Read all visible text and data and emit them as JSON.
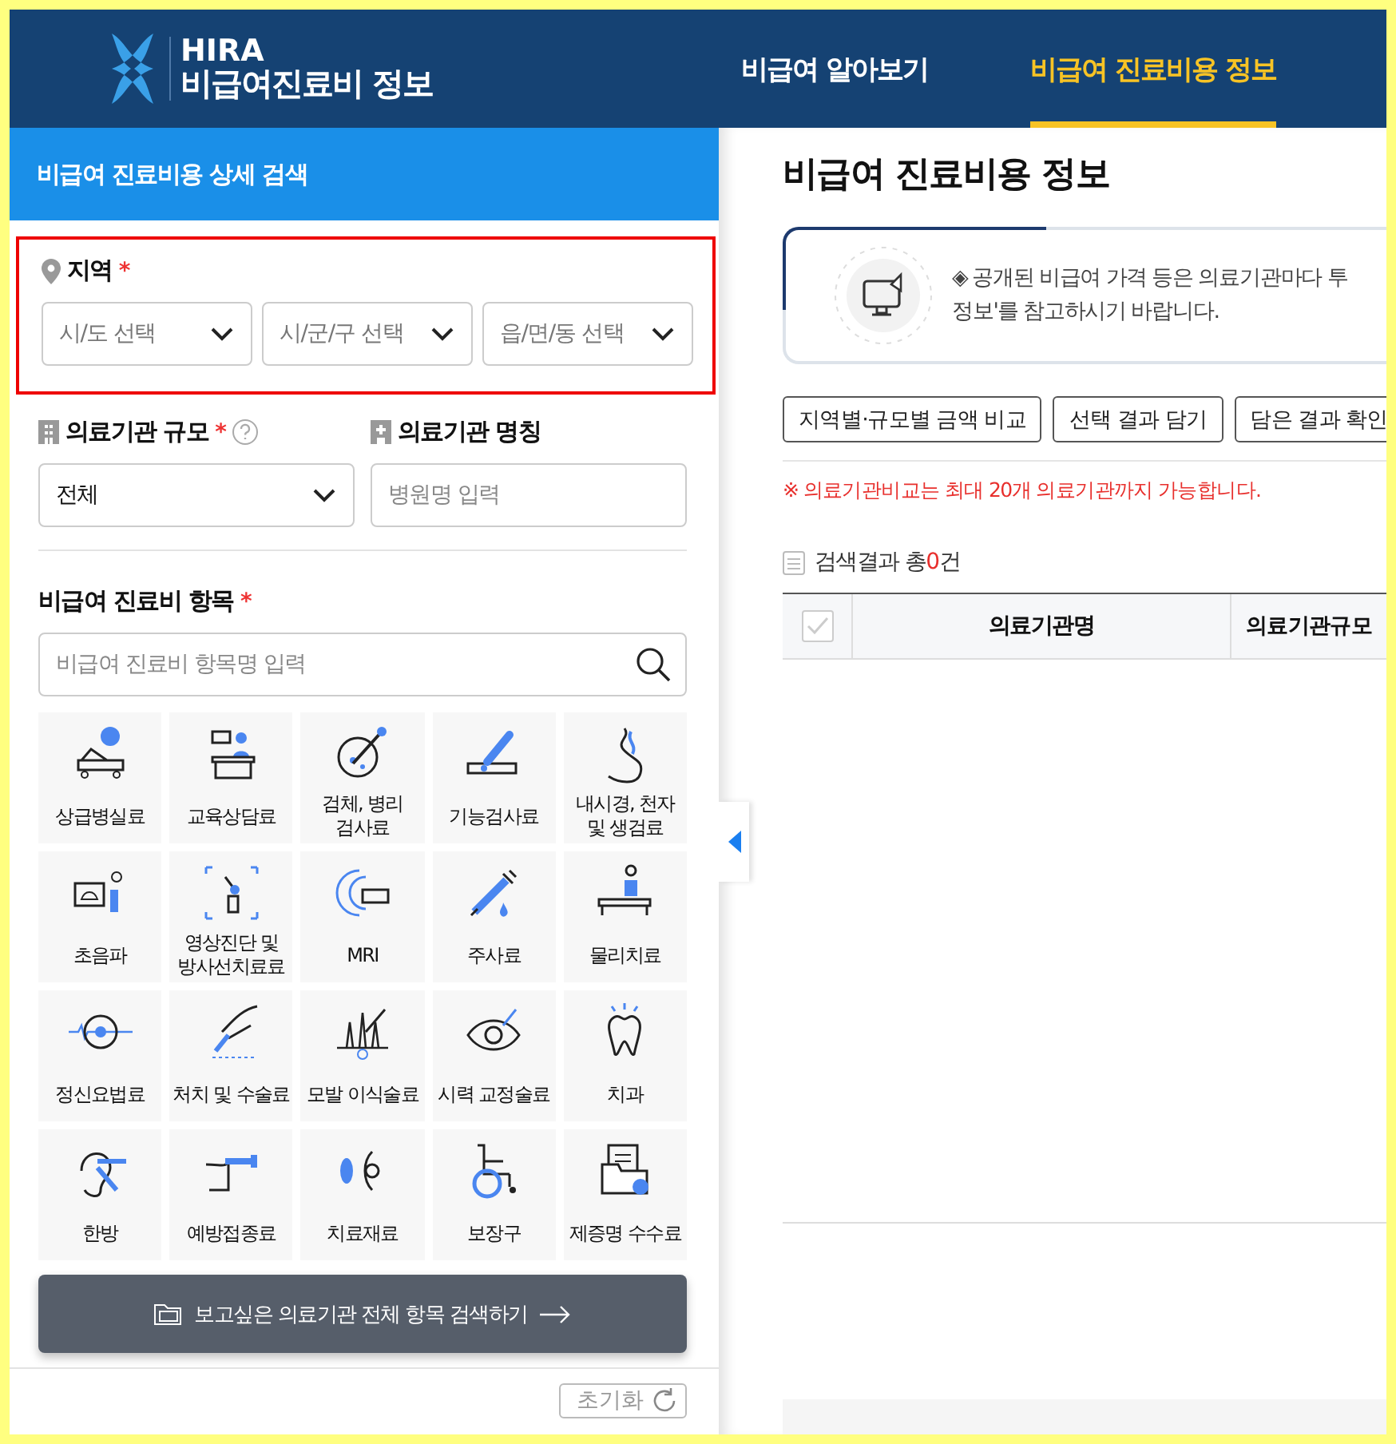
{
  "header": {
    "logo_title": "HIRA",
    "logo_subtitle": "비급여진료비 정보",
    "nav": [
      {
        "label": "비급여 알아보기",
        "selected": false
      },
      {
        "label": "비급여 진료비용 정보",
        "selected": true
      }
    ]
  },
  "search_panel": {
    "title": "비급여 진료비용 상세 검색",
    "region": {
      "label": "지역",
      "required_mark": "*",
      "highlighted": true,
      "selects": [
        {
          "placeholder": "시/도 선택"
        },
        {
          "placeholder": "시/군/구 선택"
        },
        {
          "placeholder": "읍/면/동 선택"
        }
      ]
    },
    "size": {
      "label": "의료기관 규모",
      "required_mark": "*",
      "value": "전체"
    },
    "name": {
      "label": "의료기관 명칭",
      "placeholder": "병원명 입력"
    },
    "items": {
      "label": "비급여 진료비 항목",
      "required_mark": "*",
      "placeholder": "비급여 진료비 항목명 입력",
      "categories": [
        {
          "label": "상급병실료"
        },
        {
          "label": "교육상담료"
        },
        {
          "label": "검체, 병리\n검사료"
        },
        {
          "label": "기능검사료"
        },
        {
          "label": "내시경, 천자\n및 생검료"
        },
        {
          "label": "초음파"
        },
        {
          "label": "영상진단 및\n방사선치료료"
        },
        {
          "label": "MRI"
        },
        {
          "label": "주사료"
        },
        {
          "label": "물리치료"
        },
        {
          "label": "정신요법료"
        },
        {
          "label": "처치 및 수술료"
        },
        {
          "label": "모발 이식술료"
        },
        {
          "label": "시력 교정술료"
        },
        {
          "label": "치과"
        },
        {
          "label": "한방"
        },
        {
          "label": "예방접종료"
        },
        {
          "label": "치료재료"
        },
        {
          "label": "보장구"
        },
        {
          "label": "제증명 수수료"
        }
      ]
    },
    "search_all_button": "보고싶은 의료기관 전체 항목 검색하기",
    "reset_button": "초기화"
  },
  "results": {
    "title": "비급여 진료비용 정보",
    "notice": [
      "◈ 공개된 비급여 가격 등은 의료기관마다 투",
      "정보'를 참고하시기 바랍니다."
    ],
    "buttons": [
      "지역별·규모별 금액 비교",
      "선택 결과 담기",
      "담은 결과 확인"
    ],
    "limit_note": "※ 의료기관비교는 최대 20개 의료기관까지 가능합니다.",
    "count": {
      "prefix": "검색결과 총",
      "value": "0",
      "suffix": "건"
    },
    "table": {
      "select_all": {
        "checked": false
      },
      "columns": [
        "의료기관명",
        "의료기관규모"
      ]
    }
  }
}
